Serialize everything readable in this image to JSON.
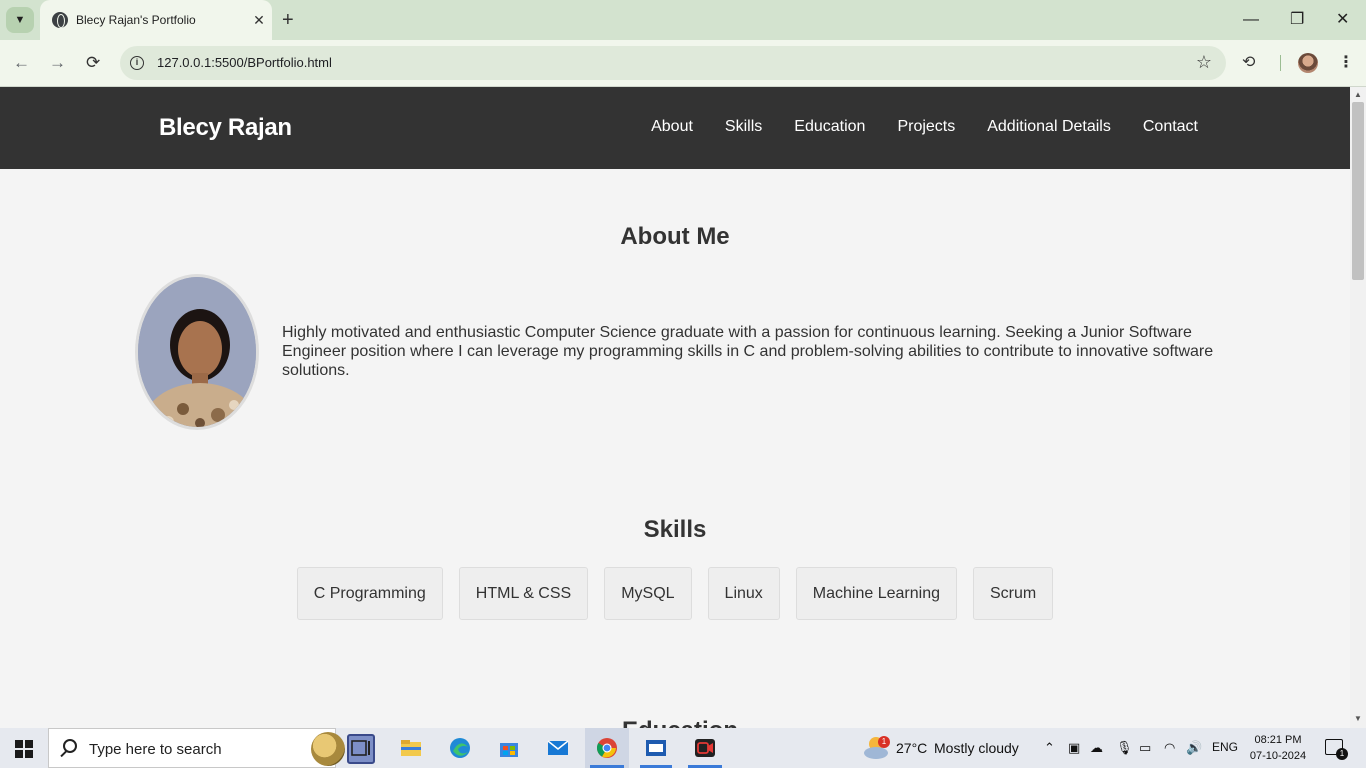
{
  "browser": {
    "tab_title": "Blecy Rajan's Portfolio",
    "tab_close": "✕",
    "new_tab": "+",
    "url": "127.0.0.1:5500/BPortfolio.html",
    "window": {
      "minimize": "—",
      "restore": "❐",
      "close": "✕"
    },
    "nav": {
      "back": "←",
      "forward": "→",
      "reload": "⟳",
      "star": "☆",
      "history": "⟲",
      "menu": "⋮"
    }
  },
  "site": {
    "brand": "Blecy Rajan",
    "nav": [
      "About",
      "Skills",
      "Education",
      "Projects",
      "Additional Details",
      "Contact"
    ],
    "about": {
      "title": "About Me",
      "text": "Highly motivated and enthusiastic Computer Science graduate with a passion for continuous learning. Seeking a Junior Software Engineer position where I can leverage my programming skills in C and problem-solving abilities to contribute to innovative software solutions."
    },
    "skills": {
      "title": "Skills",
      "items": [
        "C Programming",
        "HTML & CSS",
        "MySQL",
        "Linux",
        "Machine Learning",
        "Scrum"
      ]
    },
    "next_section_title_peek": "Education"
  },
  "taskbar": {
    "search_placeholder": "Type here to search",
    "weather_temp": "27°C",
    "weather_desc": "Mostly cloudy",
    "language": "ENG",
    "time": "08:21 PM",
    "date": "07-10-2024",
    "notification_count": "1",
    "weather_badge": "1"
  },
  "colors": {
    "header_bg": "#333333",
    "page_bg": "#f4f4f4",
    "skill_bg": "#eeeeee",
    "tabbar_bg": "#d3e3cf"
  }
}
